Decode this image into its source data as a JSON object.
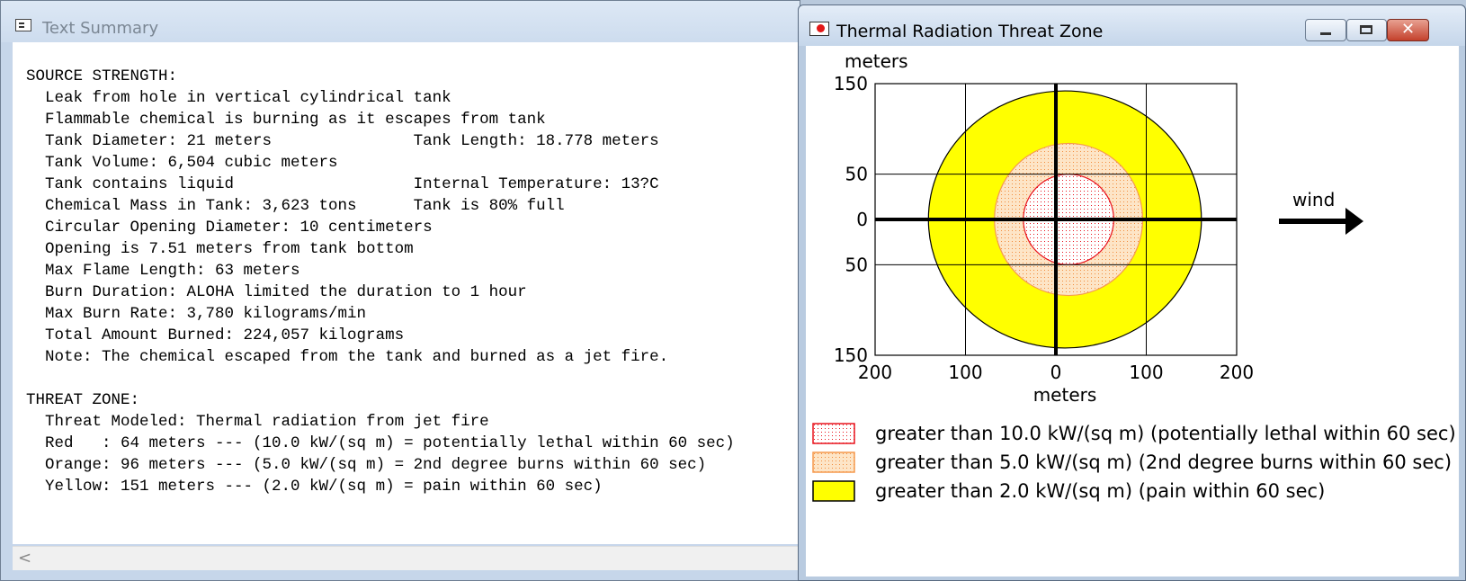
{
  "text_summary": {
    "title": "Text Summary",
    "lines": [
      "SOURCE STRENGTH:",
      "  Leak from hole in vertical cylindrical tank",
      "  Flammable chemical is burning as it escapes from tank",
      "  Tank Diameter: 21 meters               Tank Length: 18.778 meters",
      "  Tank Volume: 6,504 cubic meters",
      "  Tank contains liquid                   Internal Temperature: 13?C",
      "  Chemical Mass in Tank: 3,623 tons      Tank is 80% full",
      "  Circular Opening Diameter: 10 centimeters",
      "  Opening is 7.51 meters from tank bottom",
      "  Max Flame Length: 63 meters",
      "  Burn Duration: ALOHA limited the duration to 1 hour",
      "  Max Burn Rate: 3,780 kilograms/min",
      "  Total Amount Burned: 224,057 kilograms",
      "  Note: The chemical escaped from the tank and burned as a jet fire.",
      "",
      "THREAT ZONE:",
      "  Threat Modeled: Thermal radiation from jet fire",
      "  Red   : 64 meters --- (10.0 kW/(sq m) = potentially lethal within 60 sec)",
      "  Orange: 96 meters --- (5.0 kW/(sq m) = 2nd degree burns within 60 sec)",
      "  Yellow: 151 meters --- (2.0 kW/(sq m) = pain within 60 sec)"
    ],
    "scroll_left_glyph": "<"
  },
  "threat_zone": {
    "title": "Thermal Radiation Threat Zone",
    "controls": {
      "minimize": "minimize-icon",
      "maximize": "maximize-icon",
      "close_glyph": "✕"
    },
    "chart_data": {
      "type": "threat-zone-map",
      "y_axis_title": "meters",
      "x_axis_title": "meters",
      "x_range": [
        -200,
        200
      ],
      "y_range": [
        -150,
        150
      ],
      "x_ticks": [
        -200,
        -100,
        0,
        100,
        200
      ],
      "x_tick_labels": [
        "200",
        "100",
        "0",
        "100",
        "200"
      ],
      "y_ticks": [
        150,
        50,
        0,
        -50,
        -150
      ],
      "y_tick_labels": [
        "150",
        "50",
        "0",
        "50",
        "150"
      ],
      "grid": true,
      "wind_label": "wind",
      "zones": [
        {
          "name": "yellow",
          "center_x": 10,
          "radius_x": 151,
          "radius_y": 142,
          "fill": "#ffff00",
          "stroke": "#000000"
        },
        {
          "name": "orange",
          "center_x": 14,
          "radius_x": 82,
          "radius_y": 84,
          "fill": "#fde5c7",
          "stroke": "#f59a4e",
          "dots": "#f28c3c"
        },
        {
          "name": "red",
          "center_x": 14,
          "radius_x": 50,
          "radius_y": 50,
          "fill": "#ffffff",
          "stroke": "#e8141d",
          "dots": "#e8141d"
        }
      ],
      "legend": [
        {
          "zone": "red",
          "label": "greater than 10.0 kW/(sq m) (potentially lethal within 60 sec)"
        },
        {
          "zone": "orange",
          "label": "greater than 5.0 kW/(sq m) (2nd degree burns within 60 sec)"
        },
        {
          "zone": "yellow",
          "label": "greater than 2.0 kW/(sq m) (pain within 60 sec)"
        }
      ]
    }
  }
}
